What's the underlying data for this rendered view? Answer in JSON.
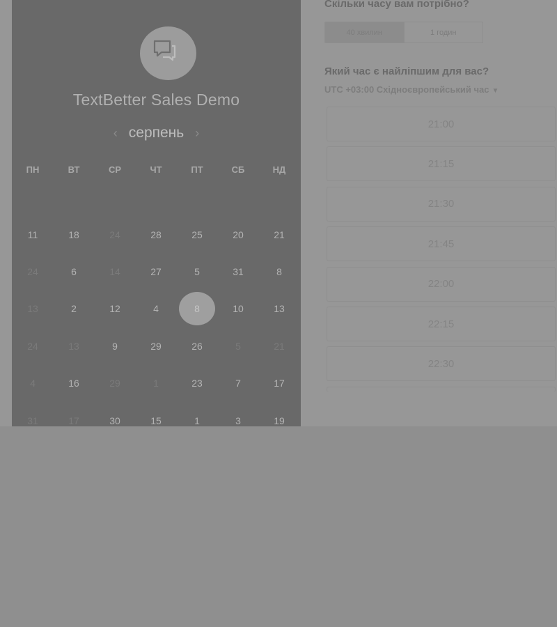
{
  "booking": {
    "title": "TextBetter Sales Demo",
    "calendar": {
      "month": "серпень",
      "weekdays": [
        "ПН",
        "ВТ",
        "СР",
        "ЧТ",
        "ПТ",
        "СБ",
        "НД"
      ],
      "rows": [
        [
          {
            "d": "11",
            "m": false
          },
          {
            "d": "18",
            "m": false
          },
          {
            "d": "24",
            "m": true
          },
          {
            "d": "28",
            "m": false
          },
          {
            "d": "25",
            "m": false
          },
          {
            "d": "20",
            "m": false
          },
          {
            "d": "21",
            "m": false
          }
        ],
        [
          {
            "d": "24",
            "m": true
          },
          {
            "d": "6",
            "m": false
          },
          {
            "d": "14",
            "m": true
          },
          {
            "d": "27",
            "m": false
          },
          {
            "d": "5",
            "m": false
          },
          {
            "d": "31",
            "m": false
          },
          {
            "d": "8",
            "m": false
          }
        ],
        [
          {
            "d": "13",
            "m": true
          },
          {
            "d": "2",
            "m": false
          },
          {
            "d": "12",
            "m": false
          },
          {
            "d": "4",
            "m": false
          },
          {
            "d": "8",
            "m": false,
            "sel": true
          },
          {
            "d": "10",
            "m": false
          },
          {
            "d": "13",
            "m": false
          }
        ],
        [
          {
            "d": "24",
            "m": true
          },
          {
            "d": "13",
            "m": true
          },
          {
            "d": "9",
            "m": false
          },
          {
            "d": "29",
            "m": false
          },
          {
            "d": "26",
            "m": false
          },
          {
            "d": "5",
            "m": true
          },
          {
            "d": "21",
            "m": true
          }
        ],
        [
          {
            "d": "4",
            "m": true
          },
          {
            "d": "16",
            "m": false
          },
          {
            "d": "29",
            "m": true
          },
          {
            "d": "1",
            "m": true
          },
          {
            "d": "23",
            "m": false
          },
          {
            "d": "7",
            "m": false
          },
          {
            "d": "17",
            "m": false
          }
        ],
        [
          {
            "d": "31",
            "m": true
          },
          {
            "d": "17",
            "m": true
          },
          {
            "d": "30",
            "m": false
          },
          {
            "d": "15",
            "m": false
          },
          {
            "d": "1",
            "m": false
          },
          {
            "d": "3",
            "m": false
          },
          {
            "d": "19",
            "m": false
          }
        ]
      ]
    },
    "duration": {
      "question": "Скільки часу вам потрібно?",
      "options": [
        "40 хвилин",
        "1 годин"
      ],
      "selected": "40 хвилин"
    },
    "time": {
      "question": "Який час є найліпшим для вас?",
      "timezone": "UTC +03:00 Східноєвропейський час",
      "slots": [
        "21:00",
        "21:15",
        "21:30",
        "21:45",
        "22:00",
        "22:15",
        "22:30"
      ]
    }
  },
  "colors": {
    "left_panel": "#696969",
    "page_dim": "#979797",
    "overlay": "#8f8f8f"
  },
  "icons": {
    "logo": "chat-bubbles-icon",
    "prev": "chevron-left-icon",
    "next": "chevron-right-icon",
    "tz_caret": "caret-down-icon"
  }
}
